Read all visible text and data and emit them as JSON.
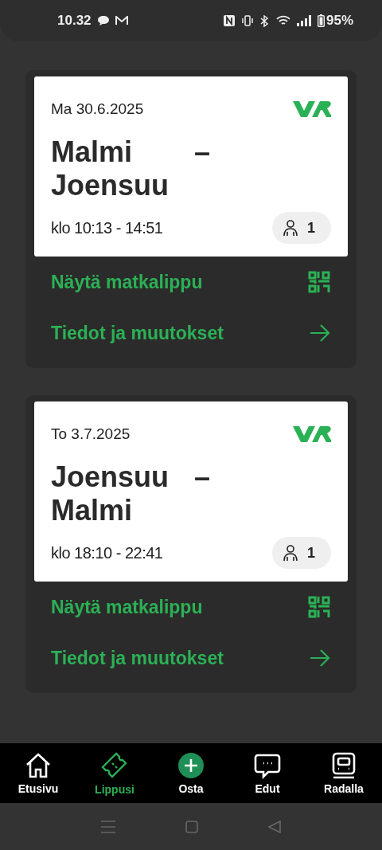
{
  "status_bar": {
    "time": "10.32",
    "battery": "95%"
  },
  "tickets": [
    {
      "date": "Ma 30.6.2025",
      "from": "Malmi",
      "separator": "–",
      "to": "Joensuu",
      "time": "klo 10:13 - 14:51",
      "passengers": "1",
      "actions": [
        "Näytä matkalippu",
        "Tiedot ja muutokset"
      ]
    },
    {
      "date": "To 3.7.2025",
      "from": "Joensuu",
      "separator": "–",
      "to": "Malmi",
      "time": "klo 18:10 - 22:41",
      "passengers": "1",
      "actions": [
        "Näytä matkalippu",
        "Tiedot ja muutokset"
      ]
    }
  ],
  "nav": [
    {
      "label": "Etusivu",
      "selected": false
    },
    {
      "label": "Lippusi",
      "selected": true
    },
    {
      "label": "Osta",
      "selected": false
    },
    {
      "label": "Edut",
      "selected": false
    },
    {
      "label": "Radalla",
      "selected": false
    }
  ]
}
